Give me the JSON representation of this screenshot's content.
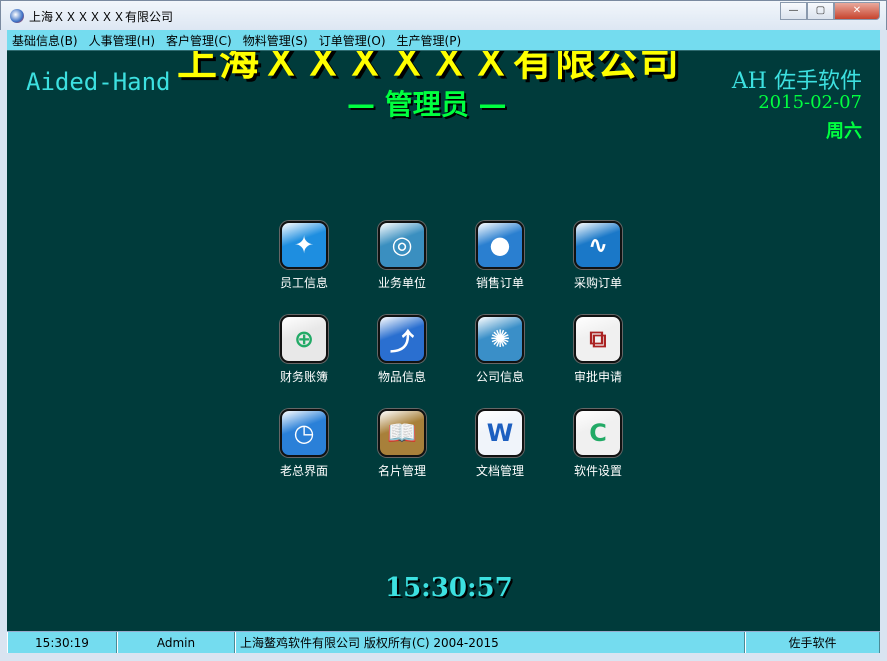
{
  "window": {
    "title": "上海ＸＸＸＸＸＸ有限公司",
    "minimize": "—",
    "maximize": "▢",
    "close": "✕"
  },
  "menu": [
    "基础信息(B)",
    "人事管理(H)",
    "客户管理(C)",
    "物料管理(S)",
    "订单管理(O)",
    "生产管理(P)"
  ],
  "header": {
    "company": "上海ＸＸＸＸＸＸ有限公司",
    "brand": "Aided-Hand",
    "role": "— 管理员 —",
    "ah": "AH 佐手软件",
    "date": "2015-02-07",
    "weekday": "周六"
  },
  "tiles": [
    {
      "label": "员工信息",
      "icon": "compass-icon",
      "color": "#1e8ee0",
      "glyph": "✦"
    },
    {
      "label": "业务单位",
      "icon": "swirl-icon",
      "color": "#3a8fc0",
      "glyph": "◎"
    },
    {
      "label": "销售订单",
      "icon": "sales-chart-icon",
      "color": "#2a7fd0",
      "glyph": "●"
    },
    {
      "label": "采购订单",
      "icon": "line-chart-icon",
      "color": "#1a78c8",
      "glyph": "∿"
    },
    {
      "label": "财务账簿",
      "icon": "bank-icon",
      "color": "#e8e8e8",
      "glyph": "⊕"
    },
    {
      "label": "物品信息",
      "icon": "curve-icon",
      "color": "#2a6fd0",
      "glyph": "⤴"
    },
    {
      "label": "公司信息",
      "icon": "aperture-icon",
      "color": "#3a8fc8",
      "glyph": "✺"
    },
    {
      "label": "审批申请",
      "icon": "vmware-icon",
      "color": "#f0f0f0",
      "glyph": "⧉"
    },
    {
      "label": "老总界面",
      "icon": "clock-icon",
      "color": "#2a80d8",
      "glyph": "◷"
    },
    {
      "label": "名片管理",
      "icon": "book-icon",
      "color": "#a8803a",
      "glyph": "📖"
    },
    {
      "label": "文档管理",
      "icon": "word-icon",
      "color": "#f0f4fa",
      "glyph": "W"
    },
    {
      "label": "软件设置",
      "icon": "settings-logo-icon",
      "color": "#f0f0f0",
      "glyph": "C"
    }
  ],
  "clock": "15:30:57",
  "status": {
    "time": "15:30:19",
    "user": "Admin",
    "copyright": "上海鳌鸡软件有限公司 版权所有(C) 2004-2015",
    "brand": "佐手软件"
  }
}
